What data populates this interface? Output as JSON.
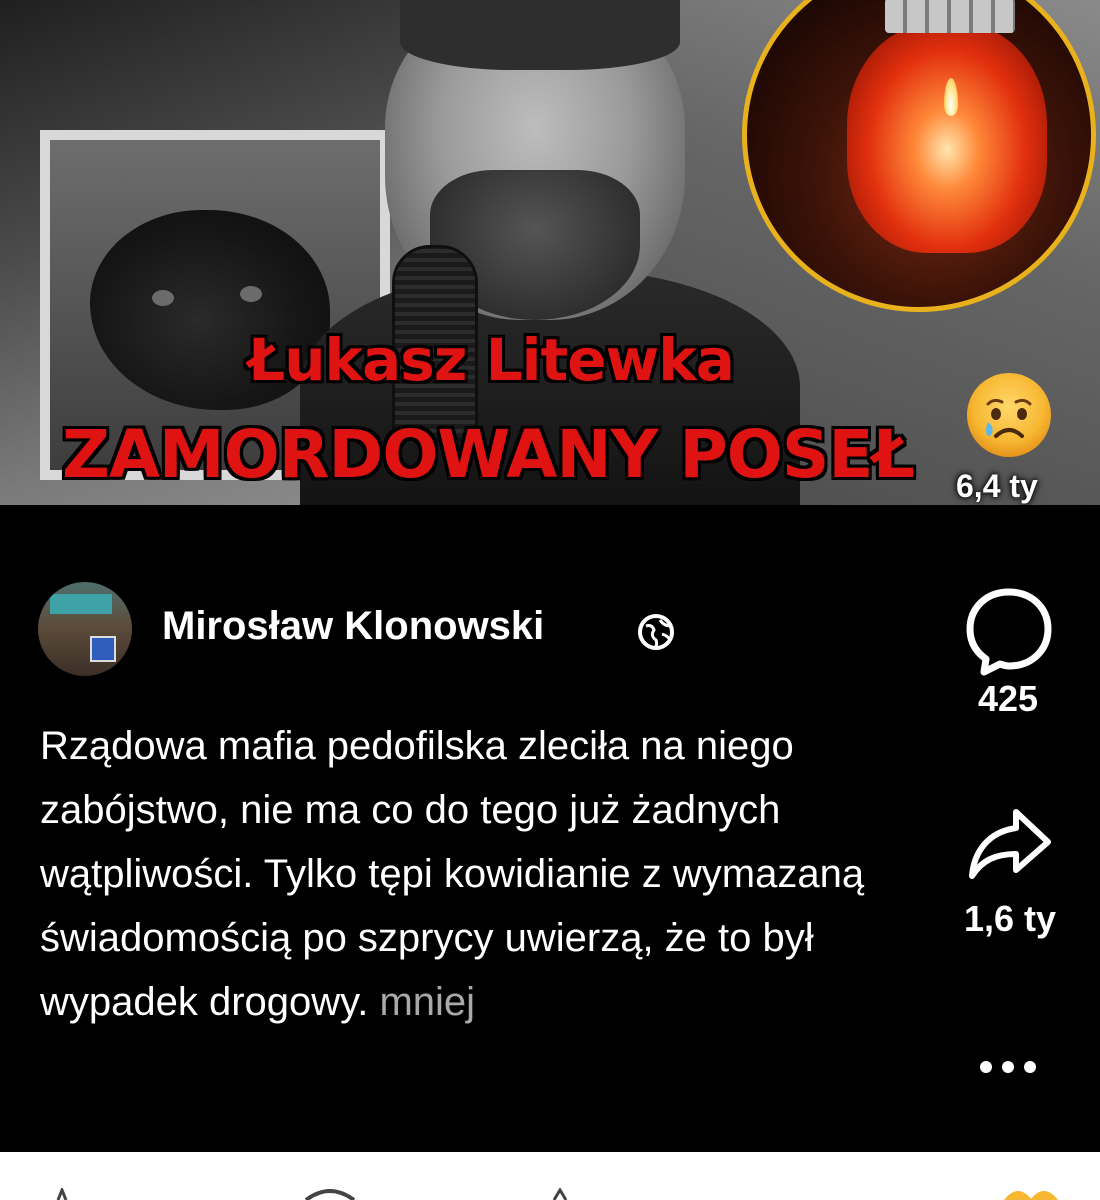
{
  "hero": {
    "headline_line1": "Łukasz Litewka",
    "headline_line2": "ZAMORDOWANY POSEŁ",
    "reaction_count": "6,4 ty"
  },
  "post": {
    "author": "Mirosław Klonowski",
    "text": "Rządowa mafia pedofilska zleciła na niego zabójstwo, nie ma co do tego już żadnych wątpliwości. Tylko tępi kowidianie z wymazaną świadomością po szprycy uwierzą, że to był wypadek drogowy.",
    "more_label": "mniej"
  },
  "actions": {
    "comment_count": "425",
    "share_count": "1,6 ty"
  },
  "icons": {
    "comment": "comment-bubble-icon",
    "share": "share-arrow-icon",
    "more": "more-dots-icon",
    "globe": "globe-icon",
    "reaction": "sad-face-emoji"
  },
  "colors": {
    "headline_red": "#e01313",
    "candle_ring": "#e9b21c",
    "background": "#000000",
    "more_link": "#a9a9a9"
  }
}
